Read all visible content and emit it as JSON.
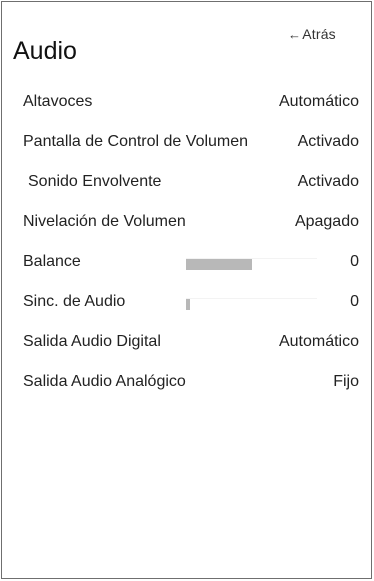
{
  "header": {
    "back_arrow": "←",
    "back_label": "Atrás",
    "title": "Audio"
  },
  "settings": [
    {
      "label": "Altavoces",
      "value": "Automático"
    },
    {
      "label": "Pantalla de Control de Volumen",
      "value": "Activado"
    },
    {
      "label": "Sonido Envolvente",
      "value": "Activado"
    },
    {
      "label": "Nivelación de Volumen",
      "value": "Apagado"
    },
    {
      "label": "Balance",
      "value": "0",
      "slider_fill": 0.5
    },
    {
      "label": "Sinc. de Audio",
      "value": "0",
      "slider_fill": 0.03
    },
    {
      "label": "Salida Audio Digital",
      "value": "Automático"
    },
    {
      "label": "Salida Audio Analógico",
      "value": "Fijo"
    }
  ],
  "colors": {
    "slider_fill": "#b8b8b8",
    "border": "#6f6f6f"
  }
}
